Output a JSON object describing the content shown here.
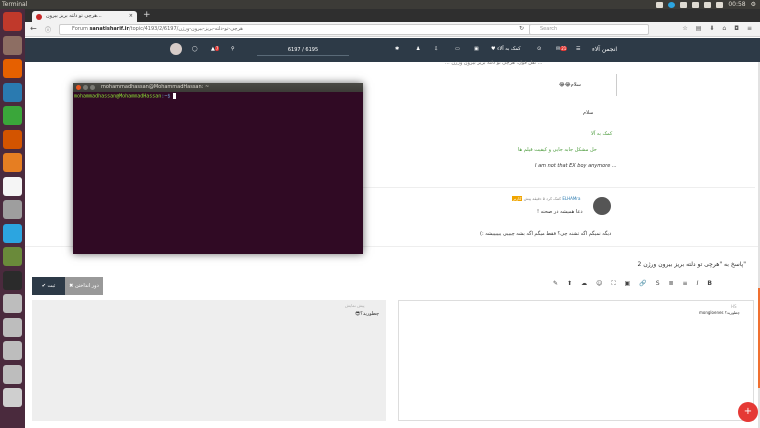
{
  "system": {
    "app_title": "Terminal",
    "clock": "00:58",
    "tray": [
      "mail-icon",
      "telegram-icon",
      "network-icon",
      "keyboard-layout-icon",
      "battery-icon",
      "volume-icon"
    ]
  },
  "launcher": {
    "items": [
      {
        "name": "ubuntu-dash-icon",
        "color": "#c0392b"
      },
      {
        "name": "files-icon",
        "color": "#8d6e63"
      },
      {
        "name": "firefox-icon",
        "color": "#e66000"
      },
      {
        "name": "writer-icon",
        "color": "#2a7ab0"
      },
      {
        "name": "calc-icon",
        "color": "#3aa63a"
      },
      {
        "name": "impress-icon",
        "color": "#d35400"
      },
      {
        "name": "software-center-icon",
        "color": "#e67e22"
      },
      {
        "name": "amazon-icon",
        "color": "#f5f5f5"
      },
      {
        "name": "settings-icon",
        "color": "#9e9e9e"
      },
      {
        "name": "telegram-launcher-icon",
        "color": "#2ca5e0"
      },
      {
        "name": "disk-app-icon",
        "color": "#6a8a3a"
      },
      {
        "name": "terminal-launcher-icon",
        "color": "#2b2b2b"
      },
      {
        "name": "drive-icon",
        "color": "#bdbdbd"
      },
      {
        "name": "drive-icon-2",
        "color": "#bdbdbd"
      },
      {
        "name": "drive-icon-3",
        "color": "#bdbdbd"
      },
      {
        "name": "drive-icon-4",
        "color": "#bdbdbd"
      },
      {
        "name": "trash-icon",
        "color": "#cfcfcf"
      }
    ],
    "count_badge": "1"
  },
  "browser": {
    "tab_title": "هرچی تو دلته بریز بیرون...",
    "url_prefix": "Forum",
    "url_host": "sanatisharif.ir",
    "url_path": "/topic/4193/2/6197/هرچی-تو-دلته-بریز-بیرون-ورژن",
    "search_placeholder": "Search"
  },
  "site_nav": {
    "brand": "انجمن آلاء",
    "help": "کمک به آلاء",
    "pager": "6197 / 6195",
    "notif_count": "7",
    "chat_count": "21"
  },
  "post1": {
    "quote_header": "... نقل قول: هرچی تو دلته بریز بیرون ورژن ...",
    "quote_text": "سلام😂😂",
    "salam": "سلام",
    "sig_line1": "کمک به آلا",
    "sig_line2": "حل مشکل جابه جایی و کیفیت فیلم ها",
    "sig_line3": "I am not that EX boy anymore ..."
  },
  "post2": {
    "author": "ELHAMra",
    "role": "کاربر",
    "time": "کمک کرد ۵ دقیقه پیش",
    "text1": "دعا همیشه در صحنه !",
    "text2": "دیگه نمیگم اگه تشنه چی؟ فقط میگم اگه بشه چیییی ییییییشه :)"
  },
  "terminal": {
    "title": "mohammadhassan@MohammadHassan: ~",
    "user": "mohammadhassan@MohammadHassan",
    "path": ":~$"
  },
  "reply": {
    "title": "پاسخ به \"هرچی تو دلته بریز بیرون ورژن 2\"",
    "submit_label": "✔ ثبت",
    "discard_label": "✖ دور انداختن",
    "preview_text": "چطورید؟😎",
    "preview_small": "پیش نمایش",
    "editor_label": "چطورید؟ mongloenes",
    "editor_small": "HS"
  },
  "toolbar": [
    "B",
    "I",
    "≡",
    "≣",
    "S",
    "🔗",
    "▣",
    "⚑",
    "☺",
    "☁",
    "⬆",
    "✎"
  ],
  "fab_label": "+"
}
